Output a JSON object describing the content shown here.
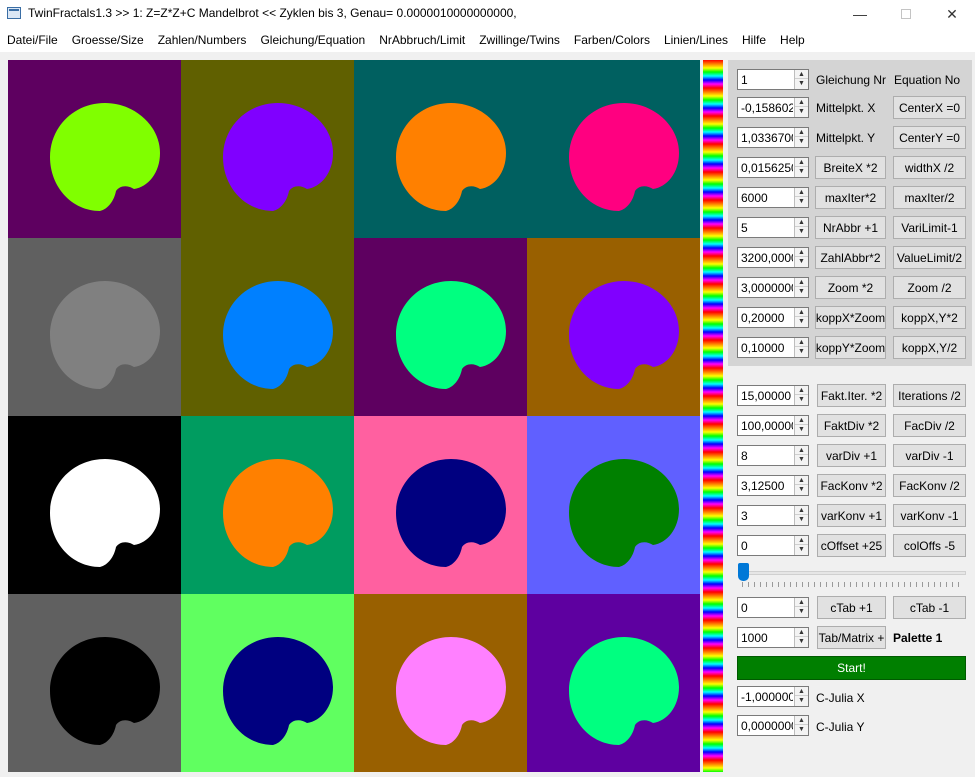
{
  "window": {
    "title": "TwinFractals1.3 >> 1: Z=Z*Z+C Mandelbrot << Zyklen bis 3, Genau= 0.0000010000000000,",
    "min_symbol": "—",
    "close_symbol": "✕"
  },
  "menu": [
    "Datei/File",
    "Groesse/Size",
    "Zahlen/Numbers",
    "Gleichung/Equation",
    "NrAbbruch/Limit",
    "Zwillinge/Twins",
    "Farben/Colors",
    "Linien/Lines",
    "Hilfe",
    "Help"
  ],
  "tiles": [
    {
      "bg": "#5e0060",
      "fg": "#80ff00"
    },
    {
      "bg": "#606000",
      "fg": "#8000ff"
    },
    {
      "bg": "#006060",
      "fg": "#ff8000"
    },
    {
      "bg": "#006060",
      "fg": "#ff0080"
    },
    {
      "bg": "#606060",
      "fg": "#808080"
    },
    {
      "bg": "#606000",
      "fg": "#0080ff"
    },
    {
      "bg": "#5e0060",
      "fg": "#00ff80"
    },
    {
      "bg": "#996000",
      "fg": "#8000ff"
    },
    {
      "bg": "#000000",
      "fg": "#ffffff"
    },
    {
      "bg": "#009c60",
      "fg": "#ff8000"
    },
    {
      "bg": "#ff60a0",
      "fg": "#000080"
    },
    {
      "bg": "#6060ff",
      "fg": "#008000"
    },
    {
      "bg": "#606060",
      "fg": "#000000"
    },
    {
      "bg": "#60ff60",
      "fg": "#000080"
    },
    {
      "bg": "#996000",
      "fg": "#ff80ff"
    },
    {
      "bg": "#5e00a0",
      "fg": "#00ff80"
    }
  ],
  "top_section": {
    "header": {
      "equation_value": "1",
      "label": "Gleichung Nr",
      "label2": "Equation No"
    },
    "rows": [
      {
        "value": "-0,158602(",
        "mid": "Mittelpkt. X",
        "mid_type": "label",
        "right": "CenterX =0"
      },
      {
        "value": "1,0336700",
        "mid": "Mittelpkt. Y",
        "mid_type": "label",
        "right": "CenterY =0"
      },
      {
        "value": "0,0156250",
        "mid": "BreiteX *2",
        "mid_type": "button",
        "right": "widthX /2"
      },
      {
        "value": "6000",
        "mid": "maxIter*2",
        "mid_type": "button",
        "right": "maxIter/2"
      },
      {
        "value": "5",
        "mid": "NrAbbr +1",
        "mid_type": "button",
        "right": "VariLimit-1"
      },
      {
        "value": "3200,0000",
        "mid": "ZahlAbbr*2",
        "mid_type": "button",
        "right": "ValueLimit/2"
      },
      {
        "value": "3,0000000",
        "mid": "Zoom *2",
        "mid_type": "button",
        "right": "Zoom /2"
      },
      {
        "value": "0,20000",
        "mid": "koppX*Zoom",
        "mid_type": "button",
        "right": "koppX,Y*2"
      },
      {
        "value": "0,10000",
        "mid": "koppY*Zoom",
        "mid_type": "button",
        "right": "koppX,Y/2"
      }
    ]
  },
  "bottom_section": {
    "rows": [
      {
        "value": "15,00000",
        "mid": "Fakt.Iter. *2",
        "right": "Iterations /2"
      },
      {
        "value": "100,00000",
        "mid": "FaktDiv *2",
        "right": "FacDiv /2"
      },
      {
        "value": "8",
        "mid": "varDiv +1",
        "right": "varDiv -1"
      },
      {
        "value": "3,12500",
        "mid": "FacKonv *2",
        "right": "FacKonv /2"
      },
      {
        "value": "3",
        "mid": "varKonv +1",
        "right": "varKonv -1"
      },
      {
        "value": "0",
        "mid": "cOffset +25",
        "right": "colOffs -5"
      }
    ],
    "slider_level": 0,
    "ctab": {
      "value": "0",
      "plus": "cTab +1",
      "minus": "cTab -1"
    },
    "matrix": {
      "value": "1000",
      "button": "Tab/Matrix +",
      "palette": "Palette 1"
    },
    "start": "Start!",
    "julia_x": {
      "value": "-1,000000(",
      "label": "C-Julia X"
    },
    "julia_y": {
      "value": "0,0000000(",
      "label": "C-Julia Y"
    }
  },
  "colors": {
    "start_button": "#007f00",
    "slider_thumb": "#0078d7"
  }
}
